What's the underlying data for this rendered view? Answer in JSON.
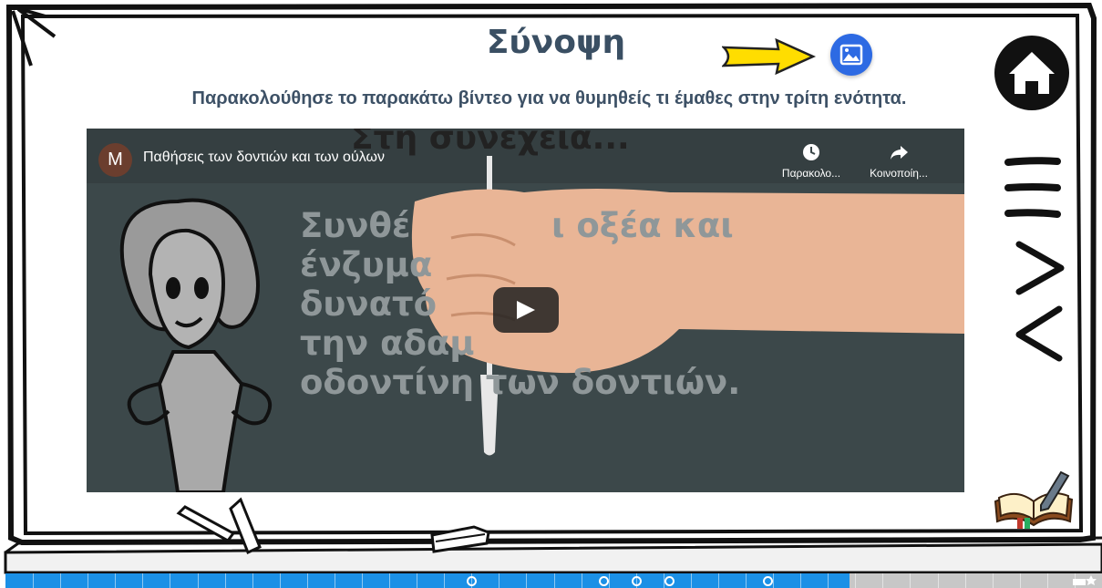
{
  "page": {
    "title": "Σύνοψη",
    "subtitle": "Παρακολούθησε το παρακάτω βίντεο για να θυμηθείς τι έμαθες στην τρίτη ενότητα."
  },
  "video": {
    "channel_initial": "M",
    "title": "Παθήσεις των δοντιών και των ούλων",
    "watch_later_label": "Παρακολο...",
    "share_label": "Κοινοποίη...",
    "heading_behind_text": "Στη συνέχεια...",
    "overlay_text": "Συνθέ            ι οξέα και\nένζυμα\nδυνατό\nτην αδαμ\nοδοντίνη των δοντιών."
  },
  "nav": {
    "home_icon": "home-icon",
    "menu_icon": "hamburger-menu-icon",
    "next_icon": "chevron-right-icon",
    "prev_icon": "chevron-left-icon",
    "notes_icon": "notebook-pen-icon",
    "image_icon": "image-icon",
    "hint_arrow_icon": "arrow-right-icon"
  },
  "progress": {
    "fraction": 0.77,
    "segments": 40,
    "marker_fractions": [
      0.425,
      0.545,
      0.575,
      0.605,
      0.695
    ]
  },
  "colors": {
    "accent_blue": "#2d6ae3",
    "progress_blue": "#1b90e6",
    "title_text": "#3a4f63",
    "arrow_yellow": "#ffdd00"
  }
}
